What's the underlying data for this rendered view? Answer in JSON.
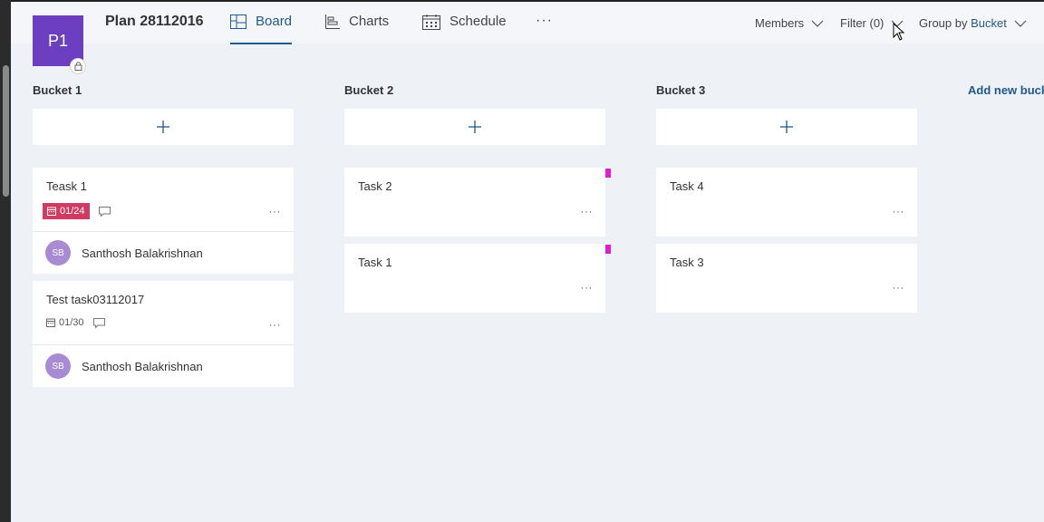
{
  "plan": {
    "avatar_initials": "P1",
    "title": "Plan 28112016"
  },
  "nav": {
    "tabs": [
      {
        "label": "Board",
        "icon": "board-icon",
        "active": true
      },
      {
        "label": "Charts",
        "icon": "charts-icon",
        "active": false
      },
      {
        "label": "Schedule",
        "icon": "schedule-icon",
        "active": false
      }
    ],
    "more": "···"
  },
  "controls": {
    "members": "Members",
    "filter": "Filter (0)",
    "group_by_prefix": "Group by",
    "group_by_value": "Bucket"
  },
  "add_new_bucket": "Add new bucket",
  "colors": {
    "accent": "#1f5a8a",
    "plan_avatar": "#6b3fbf",
    "overdue": "#d13a62",
    "label_pink": "#e31bd2",
    "assignee_avatar": "#a98bd4"
  },
  "buckets": [
    {
      "title": "Bucket 1",
      "cards": [
        {
          "title": "Teask 1",
          "due": "01/24",
          "overdue": true,
          "comments": true,
          "assignee": {
            "initials": "SB",
            "name": "Santhosh Balakrishnan"
          }
        },
        {
          "title": "Test task03112017",
          "due": "01/30",
          "overdue": false,
          "comments": true,
          "assignee": {
            "initials": "SB",
            "name": "Santhosh Balakrishnan"
          }
        }
      ]
    },
    {
      "title": "Bucket 2",
      "cards": [
        {
          "title": "Task 2",
          "label_color": "#e31bd2"
        },
        {
          "title": "Task 1",
          "label_color": "#e31bd2"
        }
      ]
    },
    {
      "title": "Bucket 3",
      "cards": [
        {
          "title": "Task 4"
        },
        {
          "title": "Task 3"
        }
      ]
    }
  ],
  "card_more": "···"
}
